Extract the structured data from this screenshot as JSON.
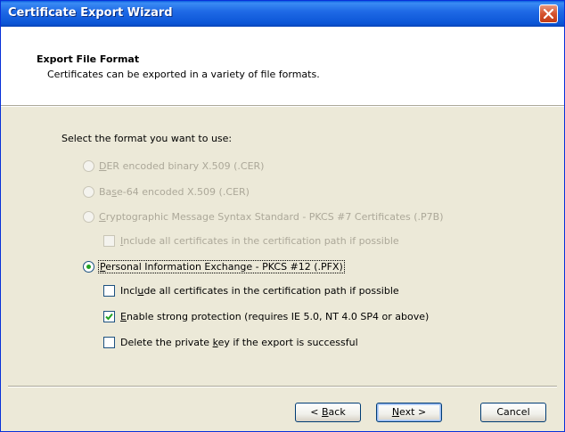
{
  "window": {
    "title": "Certificate Export Wizard",
    "close_icon": "close-icon"
  },
  "header": {
    "title": "Export File Format",
    "subtitle": "Certificates can be exported in a variety of file formats."
  },
  "prompt": "Select the format you want to use:",
  "options": [
    {
      "pre": "",
      "key": "D",
      "post": "ER encoded binary X.509 (.CER)",
      "checked": false,
      "enabled": false
    },
    {
      "pre": "Ba",
      "key": "s",
      "post": "e-64 encoded X.509 (.CER)",
      "checked": false,
      "enabled": false
    },
    {
      "pre": "",
      "key": "C",
      "post": "ryptographic Message Syntax Standard - PKCS #7 Certificates (.P7B)",
      "checked": false,
      "enabled": false
    },
    {
      "pre": "",
      "key": "P",
      "post": "ersonal Information Exchange - PKCS #12 (.PFX)",
      "checked": true,
      "enabled": true
    }
  ],
  "p7b_include": {
    "pre": "",
    "key": "I",
    "post": "nclude all certificates in the certification path if possible",
    "checked": false,
    "enabled": false
  },
  "pfx_options": [
    {
      "pre": "Incl",
      "key": "u",
      "post": "de all certificates in the certification path if possible",
      "checked": false
    },
    {
      "pre": "",
      "key": "E",
      "post": "nable strong protection (requires IE 5.0, NT 4.0 SP4 or above)",
      "checked": true
    },
    {
      "pre": "Delete the private ",
      "key": "k",
      "post": "ey if the export is successful",
      "checked": false
    }
  ],
  "buttons": {
    "back": {
      "pre": "< ",
      "key": "B",
      "post": "ack"
    },
    "next": {
      "pre": "",
      "key": "N",
      "post": "ext >"
    },
    "cancel": "Cancel"
  }
}
